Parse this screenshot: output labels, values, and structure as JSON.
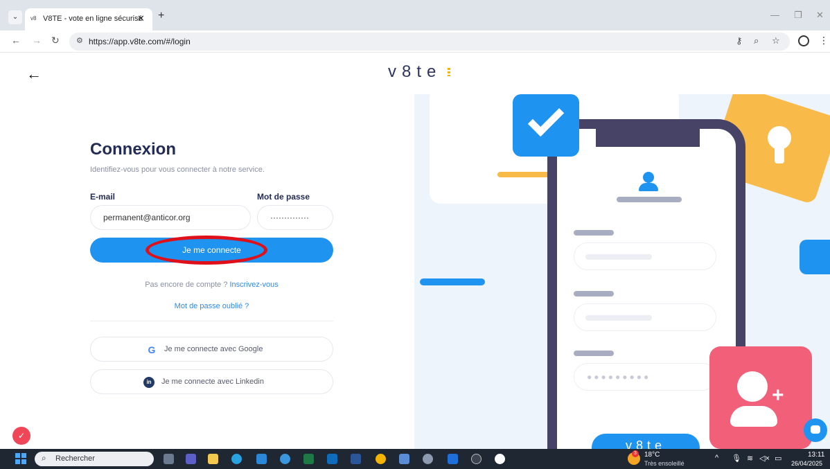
{
  "browser": {
    "tab_title": "V8TE - vote en ligne sécurisé",
    "tab_favicon": "v8",
    "url": "https://app.v8te.com/#/login"
  },
  "header": {
    "logo_text": "v8te"
  },
  "login": {
    "title": "Connexion",
    "subtitle": "Identifiez-vous pour vous connecter à notre service.",
    "email_label": "E-mail",
    "email_value": "permanent@anticor.org",
    "password_label": "Mot de passe",
    "password_value": "··············",
    "submit_label": "Je me connecte",
    "no_account_text": "Pas encore de compte ? ",
    "signup_link": "Inscrivez-vous",
    "forgot_link": "Mot de passe oublié ?",
    "google_label": "Je me connecte avec Google",
    "linkedin_label": "Je me connecte avec Linkedin",
    "google_glyph": "G",
    "linkedin_glyph": "in"
  },
  "illustration": {
    "password_dots": "●●●●●●●●●",
    "phone_logo": "v8te"
  },
  "taskbar": {
    "search_placeholder": "Rechercher",
    "weather_badge": "3",
    "weather_temp": "18°C",
    "weather_desc": "Très ensoleillé",
    "time": "13:11",
    "date": "26/04/2025"
  },
  "colors": {
    "brand_blue": "#1f93f0",
    "brand_navy": "#232c55",
    "highlight_red": "#e0101a",
    "accent_yellow": "#f8bb4a",
    "accent_pink": "#f15f79"
  }
}
